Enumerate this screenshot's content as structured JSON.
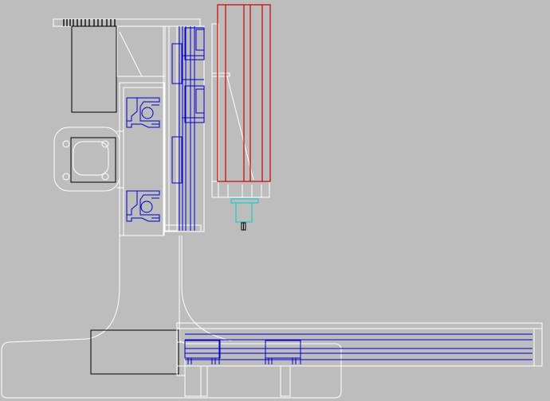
{
  "viewport": {
    "background": "#bdbdbd",
    "line_colors": {
      "outline": "#ffffff",
      "motor_blocks": "#000000",
      "rails_and_carriages": "#0000cc",
      "spindle": "#cc0000",
      "tool_holder": "#00cccc"
    }
  }
}
